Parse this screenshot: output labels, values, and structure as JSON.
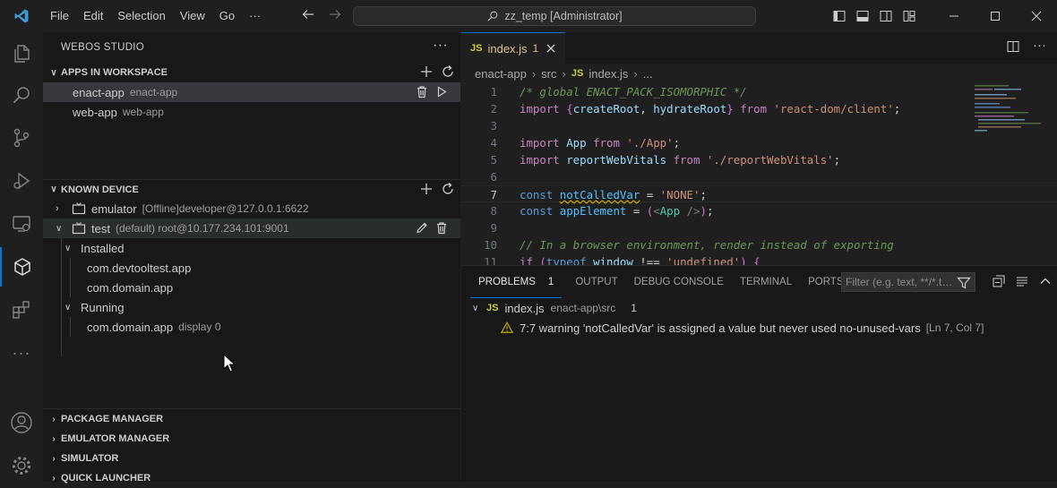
{
  "menu": [
    "File",
    "Edit",
    "Selection",
    "View",
    "Go",
    "···"
  ],
  "command_center": {
    "text": "zz_temp [Administrator]"
  },
  "sidebar": {
    "title": "WEBOS STUDIO",
    "apps_section": {
      "title": "APPS IN WORKSPACE",
      "items": [
        {
          "label": "enact-app",
          "desc": "enact-app"
        },
        {
          "label": "web-app",
          "desc": "web-app"
        }
      ]
    },
    "device_section": {
      "title": "KNOWN DEVICE",
      "devices": [
        {
          "label": "emulator",
          "desc": "[Offline]developer@127.0.0.1:6622"
        },
        {
          "label": "test",
          "desc": "(default) root@10.177.234.101:9001"
        }
      ],
      "installed_label": "Installed",
      "installed": [
        "com.devtooltest.app",
        "com.domain.app"
      ],
      "running_label": "Running",
      "running": [
        {
          "label": "com.domain.app",
          "desc": "display 0"
        }
      ]
    },
    "collapsed_sections": [
      "PACKAGE MANAGER",
      "EMULATOR MANAGER",
      "SIMULATOR",
      "QUICK LAUNCHER"
    ]
  },
  "editor": {
    "tab": {
      "badge": "JS",
      "name": "index.js",
      "count": "1"
    },
    "breadcrumbs": [
      "enact-app",
      "src",
      "index.js",
      "..."
    ],
    "lines": [
      {
        "n": "1",
        "tokens": [
          {
            "t": "/* global ENACT_PACK_ISOMORPHIC */",
            "c": "#6a9955",
            "i": true
          }
        ]
      },
      {
        "n": "2",
        "tokens": [
          {
            "t": "import ",
            "c": "#c586c0"
          },
          {
            "t": "{",
            "c": "#da70d6"
          },
          {
            "t": "createRoot",
            "c": "#9cdcfe"
          },
          {
            "t": ", ",
            "c": "#d4d4d4"
          },
          {
            "t": "hydrateRoot",
            "c": "#9cdcfe"
          },
          {
            "t": "}",
            "c": "#da70d6"
          },
          {
            "t": " from ",
            "c": "#c586c0"
          },
          {
            "t": "'react-dom/client'",
            "c": "#ce9178"
          },
          {
            "t": ";",
            "c": "#d4d4d4"
          }
        ]
      },
      {
        "n": "3",
        "tokens": []
      },
      {
        "n": "4",
        "tokens": [
          {
            "t": "import ",
            "c": "#c586c0"
          },
          {
            "t": "App",
            "c": "#9cdcfe"
          },
          {
            "t": " from ",
            "c": "#c586c0"
          },
          {
            "t": "'./App'",
            "c": "#ce9178"
          },
          {
            "t": ";",
            "c": "#d4d4d4"
          }
        ]
      },
      {
        "n": "5",
        "tokens": [
          {
            "t": "import ",
            "c": "#c586c0"
          },
          {
            "t": "reportWebVitals",
            "c": "#9cdcfe"
          },
          {
            "t": " from ",
            "c": "#c586c0"
          },
          {
            "t": "'./reportWebVitals'",
            "c": "#ce9178"
          },
          {
            "t": ";",
            "c": "#d4d4d4"
          }
        ]
      },
      {
        "n": "6",
        "tokens": []
      },
      {
        "n": "7",
        "tokens": [
          {
            "t": "const ",
            "c": "#569cd6"
          },
          {
            "t": "notCalledVar",
            "c": "#4fc1ff",
            "u": true
          },
          {
            "t": " = ",
            "c": "#d4d4d4"
          },
          {
            "t": "'NONE'",
            "c": "#ce9178"
          },
          {
            "t": ";",
            "c": "#d4d4d4"
          }
        ]
      },
      {
        "n": "8",
        "tokens": [
          {
            "t": "const ",
            "c": "#569cd6"
          },
          {
            "t": "appElement",
            "c": "#4fc1ff"
          },
          {
            "t": " = ",
            "c": "#d4d4d4"
          },
          {
            "t": "(",
            "c": "#da70d6"
          },
          {
            "t": "<",
            "c": "#808080"
          },
          {
            "t": "App",
            "c": "#4ec9b0"
          },
          {
            "t": " />",
            "c": "#808080"
          },
          {
            "t": ")",
            "c": "#da70d6"
          },
          {
            "t": ";",
            "c": "#d4d4d4"
          }
        ]
      },
      {
        "n": "9",
        "tokens": []
      },
      {
        "n": "10",
        "tokens": [
          {
            "t": "// In a browser environment, render instead of exporting",
            "c": "#6a9955",
            "i": true
          }
        ]
      },
      {
        "n": "11",
        "tokens": [
          {
            "t": "if ",
            "c": "#c586c0"
          },
          {
            "t": "(",
            "c": "#da70d6"
          },
          {
            "t": "typeof ",
            "c": "#569cd6"
          },
          {
            "t": "window",
            "c": "#9cdcfe"
          },
          {
            "t": " !== ",
            "c": "#d4d4d4"
          },
          {
            "t": "'undefined'",
            "c": "#ce9178"
          },
          {
            "t": ") {",
            "c": "#da70d6"
          }
        ]
      }
    ]
  },
  "panel": {
    "tabs": [
      {
        "label": "PROBLEMS",
        "count": "1"
      },
      {
        "label": "OUTPUT"
      },
      {
        "label": "DEBUG CONSOLE"
      },
      {
        "label": "TERMINAL"
      },
      {
        "label": "PORTS"
      }
    ],
    "filter_placeholder": "Filter (e.g. text, **/*.t…",
    "file": {
      "badge": "JS",
      "name": "index.js",
      "path": "enact-app\\src",
      "count": "1"
    },
    "problem": {
      "message": "7:7 warning 'notCalledVar' is assigned a value but never used no-unused-vars",
      "location": "[Ln 7, Col 7]"
    }
  },
  "colors": {
    "accent": "#0078d4",
    "warning": "#cca700",
    "js": "#cbcb41",
    "modified": "#e2c08d"
  }
}
